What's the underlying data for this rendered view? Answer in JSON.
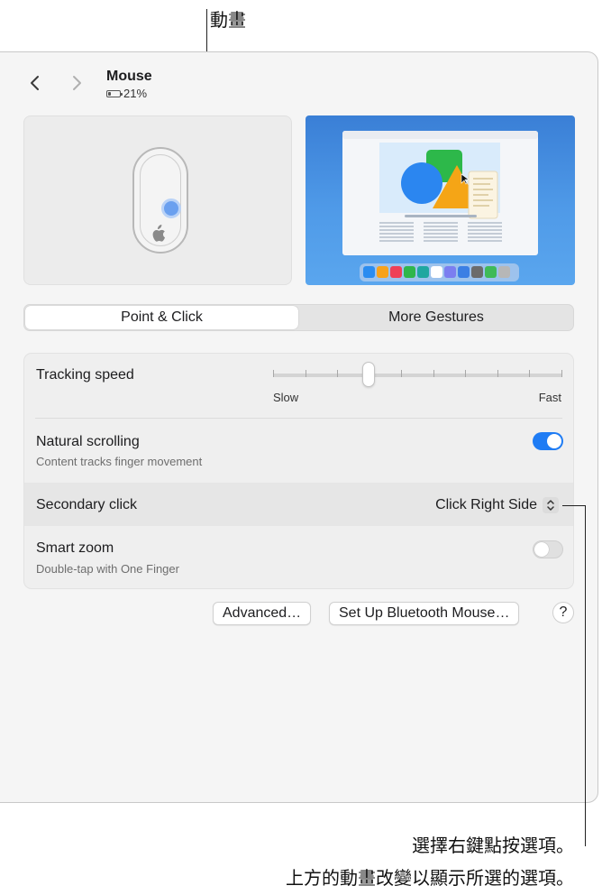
{
  "callouts": {
    "animation": "動畫",
    "secondary_line1": "選擇右鍵點按選項。",
    "secondary_line2": "上方的動畫改變以顯示所選的選項。"
  },
  "window": {
    "title": "Mouse",
    "battery": "21%",
    "tabs": [
      {
        "label": "Point & Click",
        "selected": true
      },
      {
        "label": "More Gestures",
        "selected": false
      }
    ]
  },
  "settings": {
    "tracking_speed": {
      "label": "Tracking speed",
      "min_label": "Slow",
      "max_label": "Fast",
      "value_fraction": 0.33,
      "ticks": 10
    },
    "natural_scrolling": {
      "label": "Natural scrolling",
      "sub": "Content tracks finger movement",
      "on": true
    },
    "secondary_click": {
      "label": "Secondary click",
      "value": "Click Right Side"
    },
    "smart_zoom": {
      "label": "Smart zoom",
      "sub": "Double-tap with One Finger",
      "on": false
    }
  },
  "buttons": {
    "advanced": "Advanced…",
    "setup_bt": "Set Up Bluetooth Mouse…",
    "help": "?"
  },
  "colors": {
    "accent": "#1f7cf4",
    "window_bg": "#f5f5f5",
    "panel_bg": "#efefef"
  },
  "icons": [
    "chevron-left-icon",
    "chevron-right-icon",
    "battery-icon",
    "apple-logo-icon",
    "popup-chevron-icon"
  ]
}
